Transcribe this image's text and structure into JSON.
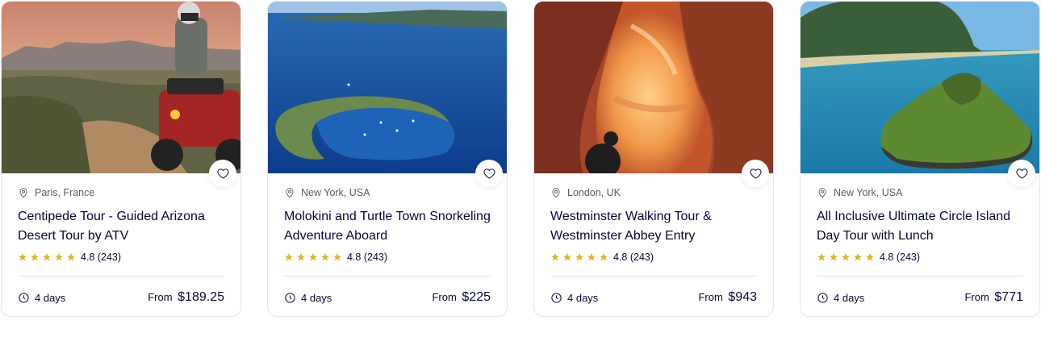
{
  "cards": [
    {
      "location": "Paris, France",
      "title": "Centipede Tour - Guided Arizona Desert Tour by ATV",
      "rating": "4.8 (243)",
      "duration": "4 days",
      "price_prefix": "From",
      "price": "$189.25",
      "image_icon": "atv-desert-image"
    },
    {
      "location": "New York, USA",
      "title": "Molokini and Turtle Town Snorkeling Adventure Aboard",
      "rating": "4.8 (243)",
      "duration": "4 days",
      "price_prefix": "From",
      "price": "$225",
      "image_icon": "crescent-island-image"
    },
    {
      "location": "London, UK",
      "title": "Westminster Walking Tour & Westminster Abbey Entry",
      "rating": "4.8 (243)",
      "duration": "4 days",
      "price_prefix": "From",
      "price": "$943",
      "image_icon": "canyon-image"
    },
    {
      "location": "New York, USA",
      "title": "All Inclusive Ultimate Circle Island Day Tour with Lunch",
      "rating": "4.8 (243)",
      "duration": "4 days",
      "price_prefix": "From",
      "price": "$771",
      "image_icon": "tropical-island-image"
    }
  ],
  "colors": {
    "text": "#05073c",
    "muted": "#5b5b6b",
    "border": "#e7e6e6",
    "star": "#e2b325"
  }
}
